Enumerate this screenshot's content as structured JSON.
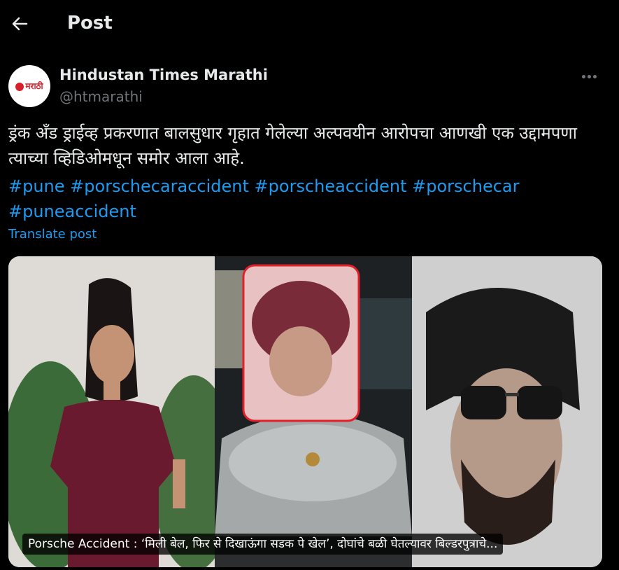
{
  "header": {
    "title": "Post"
  },
  "author": {
    "name": "Hindustan Times Marathi",
    "handle": "@htmarathi",
    "avatar_logo": "मराठी"
  },
  "post": {
    "text": "ड्रंक अँड ड्राईव्ह प्रकरणात बालसुधार गृहात गेलेल्या अल्पवयीन आरोपचा आणखी एक उद्दामपणा त्याच्या व्हिडिओमधून समोर आला आहे.",
    "hashtags": [
      "#pune",
      "#porschecaraccident",
      "#porscheaccident",
      "#porschecar",
      "#puneaccident"
    ],
    "translate_label": "Translate post"
  },
  "media": {
    "caption": "Porsche Accident : ‘मिली बेल, फिर से दिखाऊंगा सडक पे खेल’, दोघांचे बळी घेतल्यावर बिल्डरपुत्राचे..."
  },
  "colors": {
    "background": "#000000",
    "text": "#e7e9ea",
    "muted": "#71767b",
    "accent": "#1d9bf0"
  },
  "icons": {
    "back": "arrow-left-icon",
    "more": "more-horizontal-icon"
  }
}
